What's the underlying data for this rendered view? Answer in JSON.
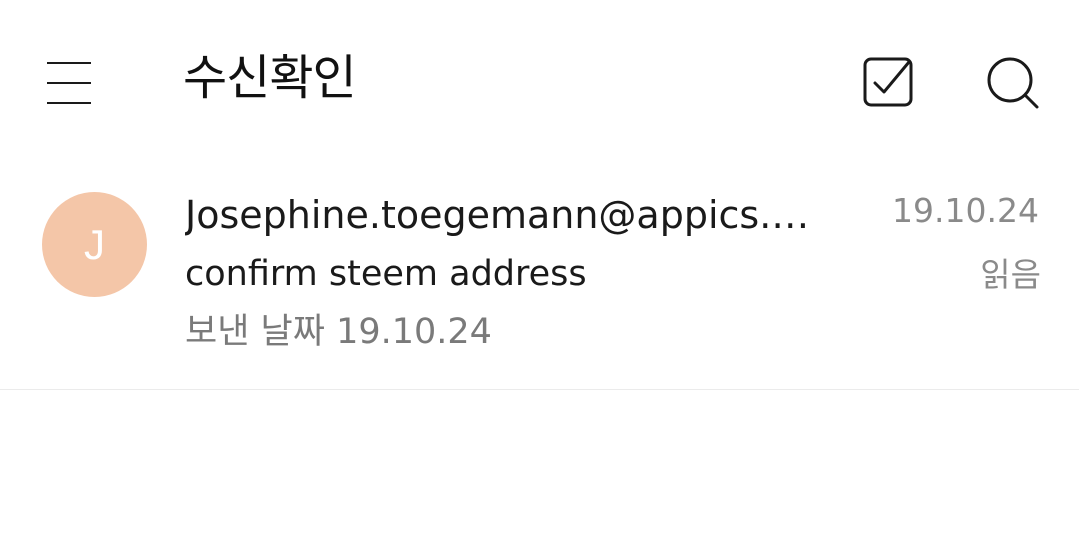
{
  "header": {
    "title": "수신확인",
    "menu_icon": "hamburger-menu-icon",
    "select_icon": "checkbox-check-icon",
    "search_icon": "search-icon"
  },
  "mail_list": [
    {
      "avatar_letter": "J",
      "avatar_color": "#f4c6a8",
      "sender": "Josephine.toegemann@appics.com",
      "subject": "confirm steem address",
      "sent_label": "보낸 날짜",
      "sent_date": "19.10.24",
      "date": "19.10.24",
      "status": "읽음"
    }
  ]
}
